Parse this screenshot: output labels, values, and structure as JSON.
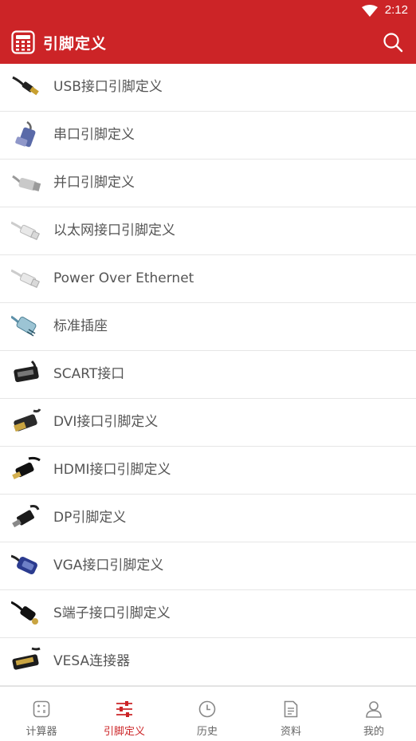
{
  "status": {
    "time": "2:12"
  },
  "appbar": {
    "title": "引脚定义"
  },
  "items": [
    {
      "label": "USB接口引脚定义",
      "icon": "usb-cable-icon"
    },
    {
      "label": "串口引脚定义",
      "icon": "serial-port-icon"
    },
    {
      "label": "并口引脚定义",
      "icon": "parallel-port-icon"
    },
    {
      "label": "以太网接口引脚定义",
      "icon": "ethernet-cable-icon"
    },
    {
      "label": "Power Over Ethernet",
      "icon": "poe-cable-icon"
    },
    {
      "label": "标准插座",
      "icon": "rj-connector-icon"
    },
    {
      "label": "SCART接口",
      "icon": "scart-connector-icon"
    },
    {
      "label": "DVI接口引脚定义",
      "icon": "dvi-cable-icon"
    },
    {
      "label": "HDMI接口引脚定义",
      "icon": "hdmi-cable-icon"
    },
    {
      "label": "DP引脚定义",
      "icon": "displayport-cable-icon"
    },
    {
      "label": "VGA接口引脚定义",
      "icon": "vga-cable-icon"
    },
    {
      "label": "S端子接口引脚定义",
      "icon": "s-video-cable-icon"
    },
    {
      "label": "VESA连接器",
      "icon": "vesa-connector-icon"
    }
  ],
  "tabs": [
    {
      "label": "计算器",
      "icon": "calculator-icon"
    },
    {
      "label": "引脚定义",
      "icon": "sliders-icon",
      "active": true
    },
    {
      "label": "历史",
      "icon": "clock-icon"
    },
    {
      "label": "资料",
      "icon": "document-icon"
    },
    {
      "label": "我的",
      "icon": "user-icon"
    }
  ],
  "colors": {
    "brand": "#cc2427",
    "text": "#555555",
    "tab_inactive": "#666666"
  }
}
